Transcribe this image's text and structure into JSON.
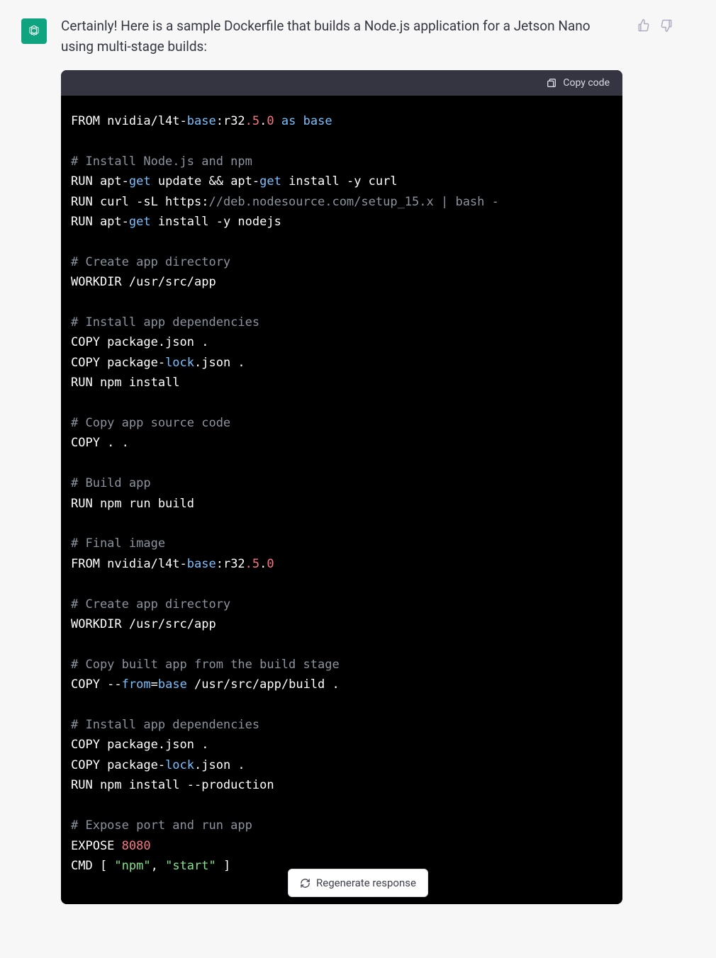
{
  "assistant_intro": "Certainly! Here is a sample Dockerfile that builds a Node.js application for a Jetson Nano using multi-stage builds:",
  "codebar": {
    "copy_label": "Copy code"
  },
  "regenerate_label": "Regenerate response",
  "icons": {
    "avatar": "openai-logo",
    "thumbs_up": "thumbs-up-icon",
    "thumbs_down": "thumbs-down-icon",
    "clipboard": "clipboard-icon",
    "refresh": "refresh-icon"
  },
  "code_tokens": [
    [
      [
        "t",
        "FROM nvidia/l4t-"
      ],
      [
        "key",
        "base"
      ],
      [
        "t",
        ":r32"
      ],
      [
        "num",
        ".5"
      ],
      [
        "t",
        "."
      ],
      [
        "num",
        "0"
      ],
      [
        "t",
        " "
      ],
      [
        "key",
        "as"
      ],
      [
        "t",
        " "
      ],
      [
        "key",
        "base"
      ]
    ],
    [],
    [
      [
        "comment",
        "# Install Node.js and npm"
      ]
    ],
    [
      [
        "t",
        "RUN apt-"
      ],
      [
        "key",
        "get"
      ],
      [
        "t",
        " update && apt-"
      ],
      [
        "key",
        "get"
      ],
      [
        "t",
        " install -y curl"
      ]
    ],
    [
      [
        "t",
        "RUN curl -sL https:"
      ],
      [
        "comment",
        "//deb.nodesource.com/setup_15.x | bash -"
      ]
    ],
    [
      [
        "t",
        "RUN apt-"
      ],
      [
        "key",
        "get"
      ],
      [
        "t",
        " install -y nodejs"
      ]
    ],
    [],
    [
      [
        "comment",
        "# Create app directory"
      ]
    ],
    [
      [
        "t",
        "WORKDIR /usr/src/app"
      ]
    ],
    [],
    [
      [
        "comment",
        "# Install app dependencies"
      ]
    ],
    [
      [
        "t",
        "COPY package.json ."
      ]
    ],
    [
      [
        "t",
        "COPY package-"
      ],
      [
        "key",
        "lock"
      ],
      [
        "t",
        ".json ."
      ]
    ],
    [
      [
        "t",
        "RUN npm install"
      ]
    ],
    [],
    [
      [
        "comment",
        "# Copy app source code"
      ]
    ],
    [
      [
        "t",
        "COPY . ."
      ]
    ],
    [],
    [
      [
        "comment",
        "# Build app"
      ]
    ],
    [
      [
        "t",
        "RUN npm run build"
      ]
    ],
    [],
    [
      [
        "comment",
        "# Final image"
      ]
    ],
    [
      [
        "t",
        "FROM nvidia/l4t-"
      ],
      [
        "key",
        "base"
      ],
      [
        "t",
        ":r32"
      ],
      [
        "num",
        ".5"
      ],
      [
        "t",
        "."
      ],
      [
        "num",
        "0"
      ]
    ],
    [],
    [
      [
        "comment",
        "# Create app directory"
      ]
    ],
    [
      [
        "t",
        "WORKDIR /usr/src/app"
      ]
    ],
    [],
    [
      [
        "comment",
        "# Copy built app from the build stage"
      ]
    ],
    [
      [
        "t",
        "COPY --"
      ],
      [
        "key",
        "from"
      ],
      [
        "t",
        "="
      ],
      [
        "key",
        "base"
      ],
      [
        "t",
        " /usr/src/app/build ."
      ]
    ],
    [],
    [
      [
        "comment",
        "# Install app dependencies"
      ]
    ],
    [
      [
        "t",
        "COPY package.json ."
      ]
    ],
    [
      [
        "t",
        "COPY package-"
      ],
      [
        "key",
        "lock"
      ],
      [
        "t",
        ".json ."
      ]
    ],
    [
      [
        "t",
        "RUN npm install --production"
      ]
    ],
    [],
    [
      [
        "comment",
        "# Expose port and run app"
      ]
    ],
    [
      [
        "t",
        "EXPOSE "
      ],
      [
        "num",
        "8080"
      ]
    ],
    [
      [
        "t",
        "CMD [ "
      ],
      [
        "str",
        "\"npm\""
      ],
      [
        "t",
        ", "
      ],
      [
        "str",
        "\"start\""
      ],
      [
        "t",
        " ]"
      ]
    ]
  ]
}
